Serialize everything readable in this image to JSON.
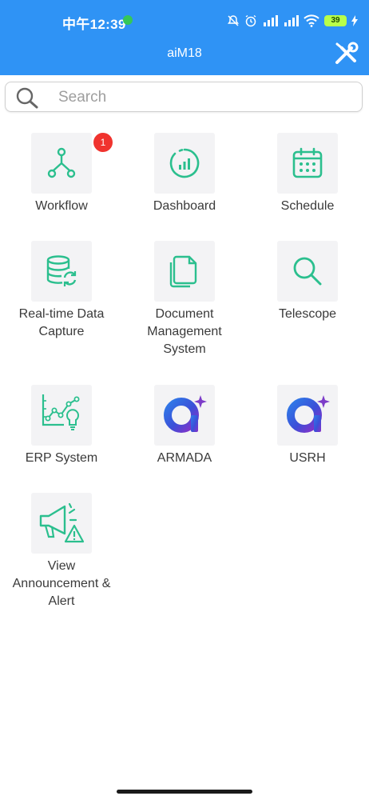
{
  "status_bar": {
    "time": "中午12:39",
    "battery": "39"
  },
  "header": {
    "title": "aiM18",
    "tools_icon": "wrench-screwdriver-icon"
  },
  "search": {
    "placeholder": "Search",
    "value": ""
  },
  "colors": {
    "header_bg": "#2f93f5",
    "icon_green": "#2bbf8e",
    "badge_red": "#f0332e"
  },
  "apps": [
    {
      "label": "Workflow",
      "icon": "workflow-icon",
      "badge": "1"
    },
    {
      "label": "Dashboard",
      "icon": "dashboard-icon"
    },
    {
      "label": "Schedule",
      "icon": "calendar-icon"
    },
    {
      "label": "Real-time Data Capture",
      "icon": "database-sync-icon"
    },
    {
      "label": "Document Management System",
      "icon": "documents-icon"
    },
    {
      "label": "Telescope",
      "icon": "magnifier-icon"
    },
    {
      "label": "ERP System",
      "icon": "chart-bulb-icon"
    },
    {
      "label": "ARMADA",
      "icon": "ai-app-logo-icon"
    },
    {
      "label": "USRH",
      "icon": "ai-app-logo-icon"
    },
    {
      "label": "View Announcement & Alert",
      "icon": "megaphone-alert-icon"
    }
  ]
}
